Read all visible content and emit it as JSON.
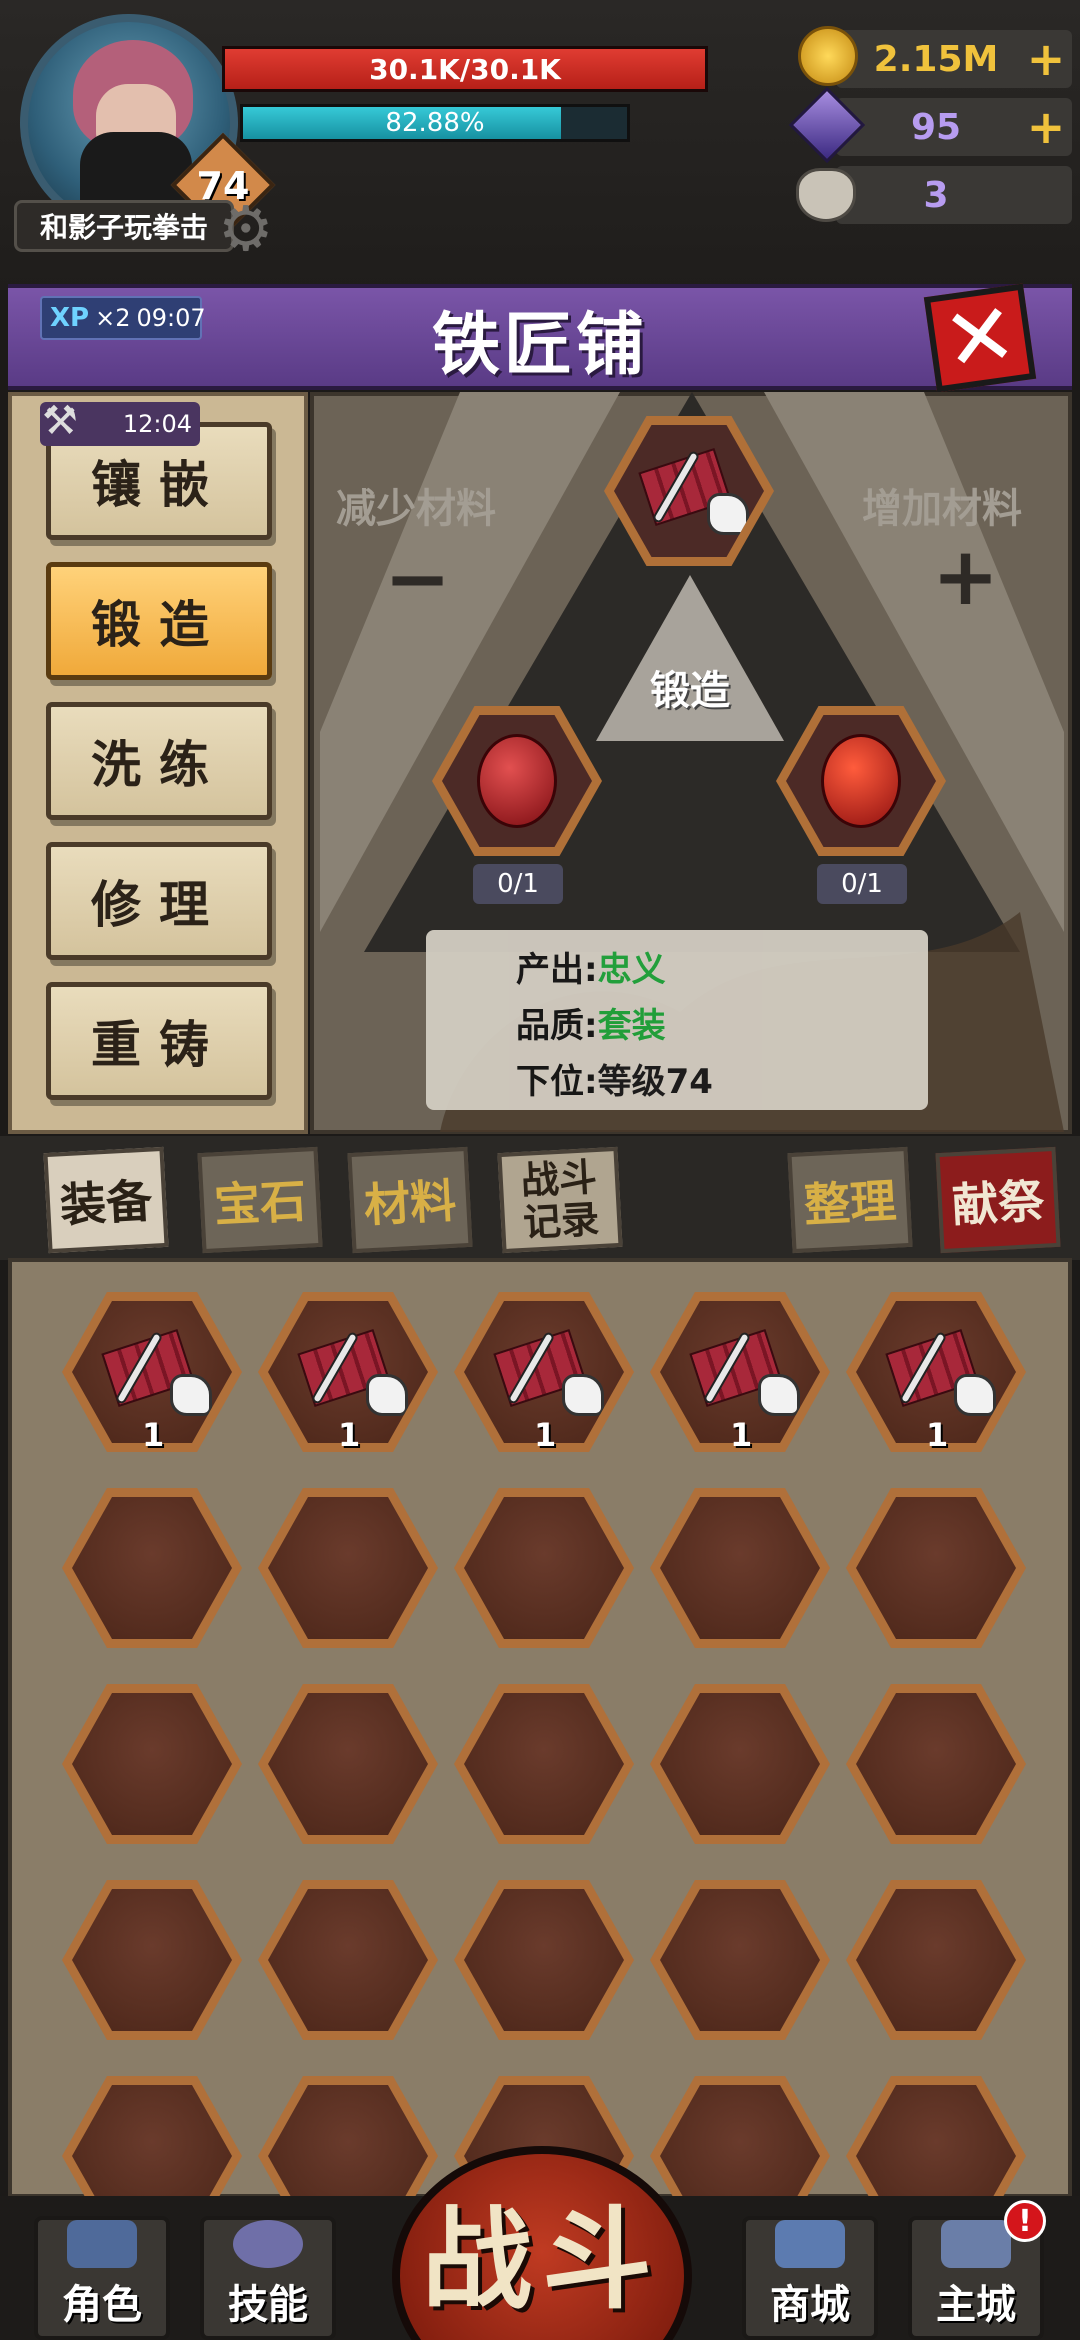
{
  "player": {
    "name": "和影子玩拳击",
    "level": "74",
    "hp_text": "30.1K/30.1K",
    "hp_fraction": 1.0,
    "xp_text": "82.88%",
    "xp_fraction": 0.8288
  },
  "currencies": {
    "gold": "2.15M",
    "crystal": "95",
    "skull": "3",
    "plus": "+"
  },
  "banner": {
    "xp_label": "XP",
    "xp_mult": "×2",
    "xp_timer": "09:07",
    "title": "铁匠铺",
    "close": "✕"
  },
  "left_menu": {
    "timer": "12:04",
    "items": [
      "镶嵌",
      "锻造",
      "洗练",
      "修理",
      "重铸"
    ],
    "active_index": 1
  },
  "forge": {
    "decrease_label": "减少材料",
    "increase_label": "增加材料",
    "minus": "−",
    "plus": "+",
    "forge_label": "锻造",
    "slot_left_count": "0/1",
    "slot_right_count": "0/1",
    "output_label": "产出:",
    "output_value": "忠义",
    "quality_label": "品质:",
    "quality_value": "套装",
    "lower_label": "下位:",
    "lower_value": "等级74"
  },
  "tabs": {
    "equipment": "装备",
    "gems": "宝石",
    "materials": "材料",
    "battle_log": "战斗记录",
    "sort": "整理",
    "sacrifice": "献祭"
  },
  "inventory": {
    "items": [
      {
        "equip": "helmet",
        "count": "1"
      },
      {
        "equip": "armor",
        "count": "1"
      },
      {
        "equip": "belt",
        "count": "1"
      },
      {
        "equip": "pants",
        "count": "1"
      },
      {
        "equip": "boots",
        "count": "1"
      }
    ]
  },
  "nav": {
    "character": "角色",
    "skills": "技能",
    "battle": "战斗",
    "shop": "商城",
    "main_city": "主城",
    "alert": "!"
  },
  "colors": {
    "hp": "#e03c32",
    "xp": "#36c9d7",
    "banner": "#7a55a8",
    "active_button": "#f0a93a",
    "green_text": "#1fa33a",
    "close_red": "#c91b1b"
  }
}
